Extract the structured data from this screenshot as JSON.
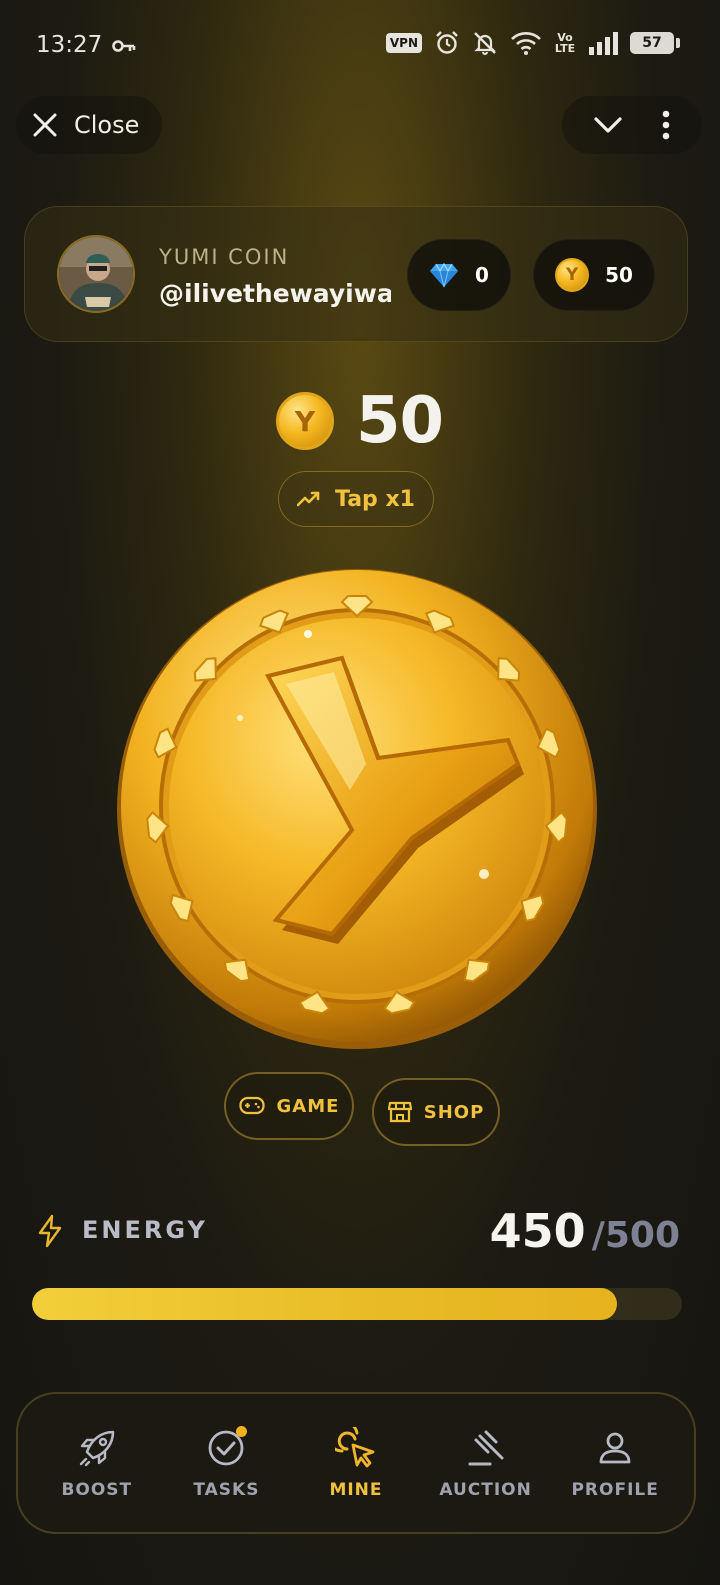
{
  "status_bar": {
    "time": "13:27",
    "vpn": "VPN",
    "network": "Vo LTE",
    "battery": "57",
    "icons": [
      "key-icon",
      "alarm-icon",
      "bell-off-icon",
      "wifi-icon",
      "signal-icon",
      "battery-icon"
    ]
  },
  "top_bar": {
    "close_label": "Close",
    "icons": [
      "close-icon",
      "chevron-down-icon",
      "more-vert-icon"
    ]
  },
  "header": {
    "app_name": "YUMI COIN",
    "username": "@ilivethewayiwa…",
    "gems": "0",
    "coins": "50"
  },
  "balance": {
    "value": "50",
    "tap_label": "Tap x1"
  },
  "actions": {
    "game_label": "GAME",
    "shop_label": "SHOP"
  },
  "energy": {
    "label": "ENERGY",
    "current": "450",
    "max": "/500",
    "fraction": 0.9
  },
  "coin_letter": "Y",
  "nav": {
    "items": [
      {
        "label": "BOOST",
        "icon": "rocket-icon",
        "active": false
      },
      {
        "label": "TASKS",
        "icon": "check-circle-icon",
        "active": false,
        "badge": true
      },
      {
        "label": "MINE",
        "icon": "tap-cursor-icon",
        "active": true
      },
      {
        "label": "AUCTION",
        "icon": "gavel-icon",
        "active": false
      },
      {
        "label": "PROFILE",
        "icon": "user-icon",
        "active": false
      }
    ]
  },
  "colors": {
    "accent": "#f0c13e",
    "energy_fill": "#e8bb26",
    "muted_text": "#9fa2ad",
    "background": "#1c1a12"
  }
}
